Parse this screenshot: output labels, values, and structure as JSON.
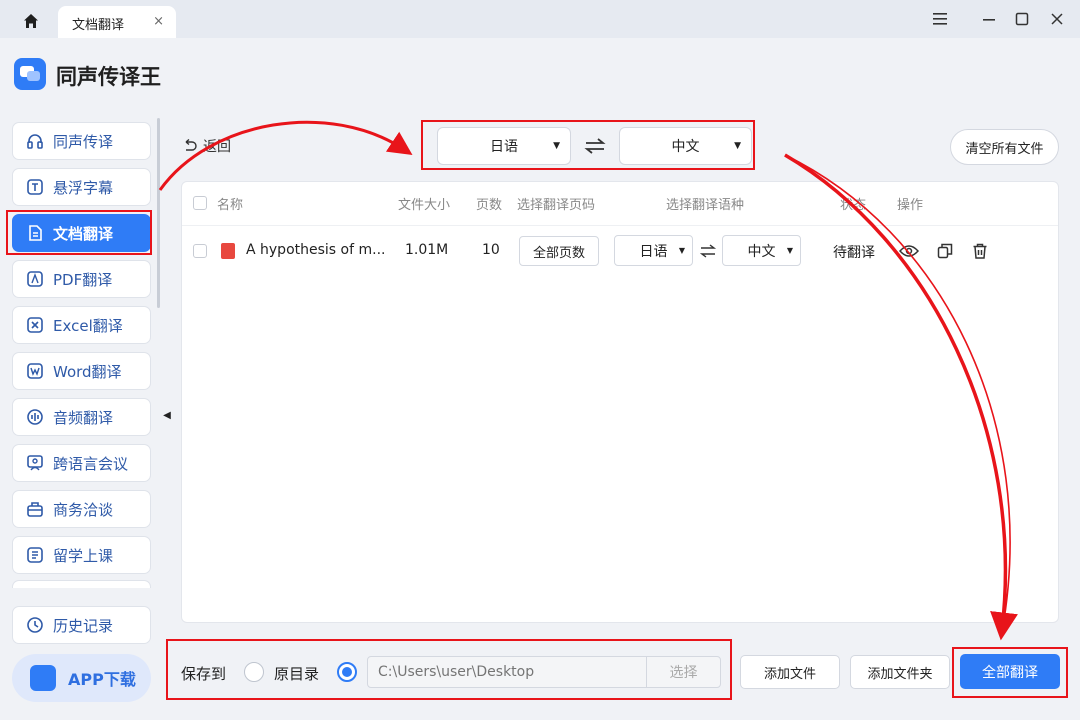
{
  "titlebar": {
    "tab_label": "文档翻译",
    "tab_close": "×"
  },
  "app": {
    "title": "同声传译王",
    "logo_icon": "app-logo-icon"
  },
  "sidebar": {
    "items": [
      {
        "label": "同声传译",
        "icon": "headphones-icon"
      },
      {
        "label": "悬浮字幕",
        "icon": "subtitle-icon"
      },
      {
        "label": "文档翻译",
        "icon": "document-icon",
        "active": true
      },
      {
        "label": "PDF翻译",
        "icon": "pdf-icon"
      },
      {
        "label": "Excel翻译",
        "icon": "excel-icon"
      },
      {
        "label": "Word翻译",
        "icon": "word-icon"
      },
      {
        "label": "音频翻译",
        "icon": "audio-icon"
      },
      {
        "label": "跨语言会议",
        "icon": "meeting-icon"
      },
      {
        "label": "商务洽谈",
        "icon": "briefcase-icon"
      },
      {
        "label": "留学上课",
        "icon": "book-icon"
      }
    ],
    "history": "历史记录",
    "app_download": "APP下载"
  },
  "toolbar": {
    "back": "返回",
    "source_lang": "日语",
    "target_lang": "中文",
    "clear_all": "清空所有文件"
  },
  "table": {
    "headers": {
      "name": "名称",
      "size": "文件大小",
      "pages": "页数",
      "page_range": "选择翻译页码",
      "languages": "选择翻译语种",
      "status": "状态",
      "actions": "操作"
    },
    "rows": [
      {
        "name": "A hypothesis of m...",
        "size": "1.01M",
        "pages": "10",
        "page_range": "全部页数",
        "source_lang": "日语",
        "target_lang": "中文",
        "status": "待翻译"
      }
    ]
  },
  "bottom": {
    "save_to": "保存到",
    "option_original": "原目录",
    "path_placeholder": "C:\\Users\\user\\Desktop",
    "choose": "选择",
    "add_file": "添加文件",
    "add_folder": "添加文件夹",
    "translate_all": "全部翻译"
  },
  "colors": {
    "accent": "#2f7cf6",
    "annotation": "#e8141a"
  }
}
